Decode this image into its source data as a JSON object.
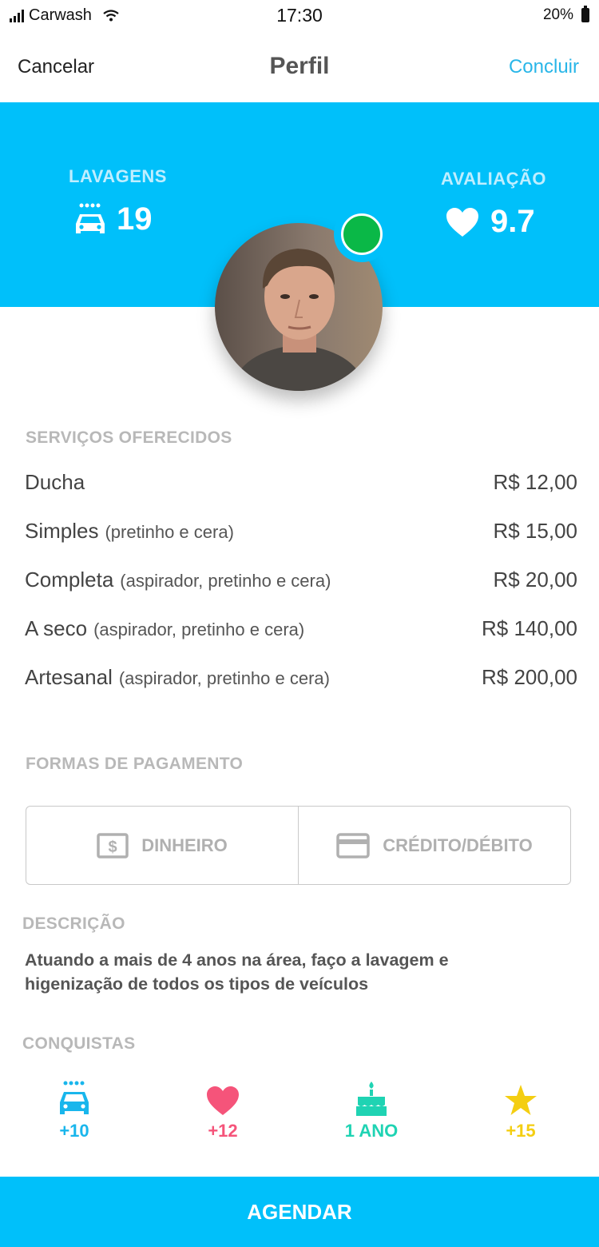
{
  "status_bar": {
    "carrier": "Carwash",
    "time": "17:30",
    "battery": "20%"
  },
  "nav": {
    "cancel": "Cancelar",
    "title": "Perfil",
    "done": "Concluir"
  },
  "stats": {
    "washes": {
      "label": "LAVAGENS",
      "value": "19",
      "icon": "car-wash-icon"
    },
    "rating": {
      "label": "AVALIAÇÃO",
      "value": "9.7",
      "icon": "heart-icon"
    }
  },
  "profile": {
    "online_status_color": "#0ab847"
  },
  "services": {
    "title": "SERVIÇOS OFERECIDOS",
    "items": [
      {
        "name": "Ducha",
        "desc": "",
        "price": "R$ 12,00"
      },
      {
        "name": "Simples",
        "desc": "(pretinho e cera)",
        "price": "R$ 15,00"
      },
      {
        "name": "Completa",
        "desc": "(aspirador, pretinho e cera)",
        "price": "R$ 20,00"
      },
      {
        "name": "A seco",
        "desc": "(aspirador, pretinho e cera)",
        "price": "R$ 140,00"
      },
      {
        "name": "Artesanal",
        "desc": "(aspirador, pretinho e cera)",
        "price": "R$ 200,00"
      }
    ]
  },
  "payments": {
    "title": "FORMAS DE PAGAMENTO",
    "options": [
      {
        "label": "DINHEIRO",
        "icon": "cash-icon"
      },
      {
        "label": "CRÉDITO/DÉBITO",
        "icon": "credit-card-icon"
      }
    ]
  },
  "description": {
    "title": "DESCRIÇÃO",
    "text": "Atuando a mais de 4 anos na área, faço a lavagem e higenização de todos os tipos de veículos"
  },
  "achievements": {
    "title": "CONQUISTAS",
    "items": [
      {
        "value": "+10",
        "icon": "car-wash-icon",
        "color": "#19b6ec"
      },
      {
        "value": "+12",
        "icon": "heart-icon",
        "color": "#f5547a"
      },
      {
        "value": "1 ANO",
        "icon": "cake-icon",
        "color": "#1fd3b3"
      },
      {
        "value": "+15",
        "icon": "star-icon",
        "color": "#f4ce12"
      }
    ]
  },
  "cta": {
    "label": "AGENDAR"
  },
  "colors": {
    "accent": "#00c0fa",
    "link": "#29b6e8"
  }
}
